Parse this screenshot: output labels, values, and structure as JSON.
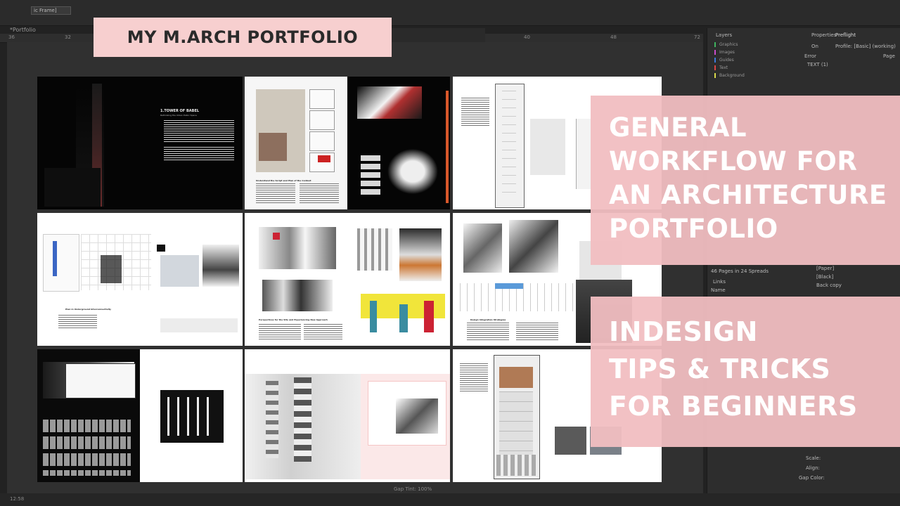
{
  "app": {
    "doc_tab": "*Portfolio",
    "frame_select": "ic Frame]",
    "ruler_numbers": [
      "36",
      "32",
      "40",
      "48",
      "72"
    ],
    "status_left": "12:58",
    "gap_tint": "Gap Tint: 100%"
  },
  "right_panel": {
    "tab_layers": "Layers",
    "tab_properties": "Properties",
    "tab_preflight": "Preflight",
    "preflight_on": "On",
    "preflight_profile": "Profile: [Basic] (working)",
    "preflight_error": "Error",
    "preflight_page": "Page",
    "preflight_item": "TEXT (1)",
    "layers": [
      {
        "name": "Graphics",
        "color": "#3fb35f"
      },
      {
        "name": "Images",
        "color": "#c94cc9"
      },
      {
        "name": "Guides",
        "color": "#3b7bd9"
      },
      {
        "name": "Text",
        "color": "#d94545"
      },
      {
        "name": "Background",
        "color": "#d9d94a"
      }
    ],
    "pages_info": "46 Pages in 24 Spreads",
    "links_title": "Links",
    "links_name": "Name",
    "swatches": [
      "[Paper]",
      "[Black]",
      "Back copy"
    ],
    "scale_label": "Scale:",
    "align_label": "Align:",
    "gap_color_label": "Gap Color:"
  },
  "overlay": {
    "title": "MY M.ARCH PORTFOLIO",
    "panel1": "GENERAL\nWORKFLOW FOR\nAN ARCHITECTURE\nPORTFOLIO",
    "panel2": "INDESIGN\nTIPS & TRICKS\nFOR BEGINNERS",
    "pink_color": "#f1bec1",
    "title_bg": "#f7cfcf"
  },
  "spreads": [
    {
      "heading": "1.TOWER OF BABEL",
      "subheading": "Rethinking the Urban Public Space"
    },
    {
      "heading": "Understand the Script and Plan of the Context"
    },
    {
      "heading": "Proposal"
    },
    {
      "heading": "Plan in Underground Interconnectivity"
    },
    {
      "heading": "Perspectives for the Site and Experiencing New Approach"
    },
    {
      "heading": "Design Integration Strategies"
    },
    {
      "heading": ""
    },
    {
      "heading": ""
    },
    {
      "heading": ""
    }
  ]
}
